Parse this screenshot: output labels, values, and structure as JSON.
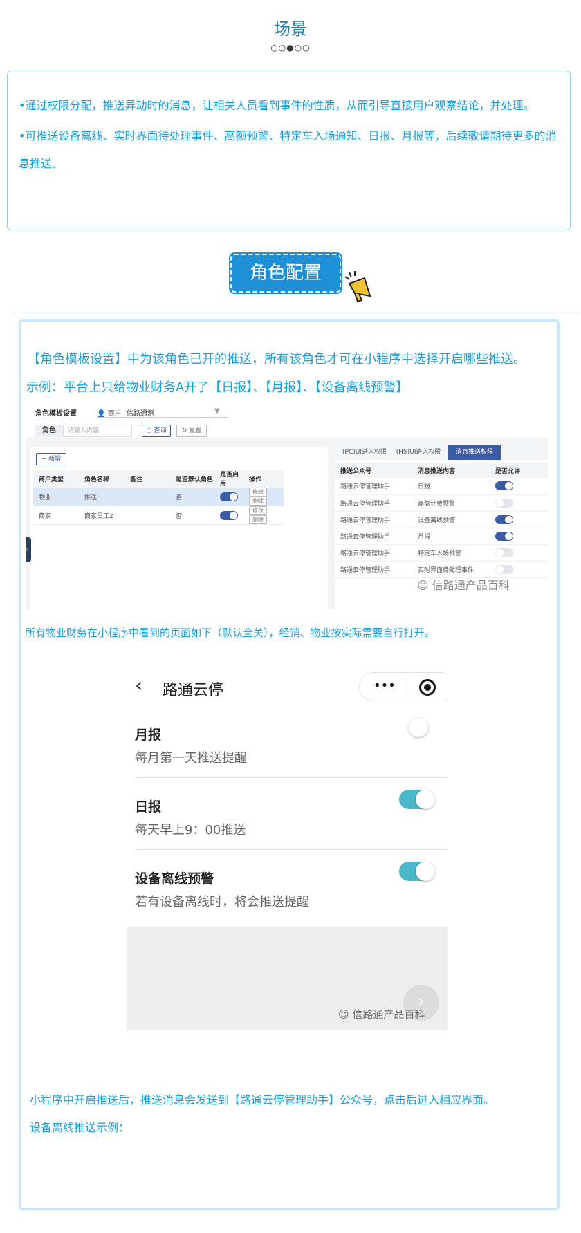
{
  "scene": {
    "title": "场景",
    "dots": "○○●○○",
    "p1": "•通过权限分配，推送异动时的消息，让相关人员看到事件的性质，从而引导直接用户观察结论，并处理。",
    "p2": "•可推送设备离线、实时界面待处理事件、高额预警、特定车入场通知、日报、月报等，后续敬请期待更多的消息推送。"
  },
  "role_config": {
    "badge": "角色配置",
    "line1": "【角色模板设置】中为该角色已开的推送，所有该角色才可在小程序中选择开启哪些推送。",
    "line2": "示例：平台上只给物业财务A开了【日报】、【月报】、【设备离线预警】"
  },
  "admin": {
    "title": "角色模板设置",
    "merchant_label": "商户",
    "merchant_value": "信路通测",
    "role_label": "角色",
    "role_placeholder": "请输入内容",
    "query_button": "查询",
    "reset_button": "重置",
    "add_button": "+ 新增",
    "left_headers": [
      "商户类型",
      "角色名称",
      "备注",
      "是否默认角色",
      "是否启用",
      "操作"
    ],
    "left_rows": [
      {
        "type": "物业",
        "name": "推送",
        "note": "",
        "default": "否",
        "enabled": true
      },
      {
        "type": "商家",
        "name": "商家员工2",
        "note": "",
        "default": "否",
        "enabled": true
      }
    ],
    "edit_label": "修改",
    "delete_label": "删除",
    "tabs": [
      "(PC)UI进入权限",
      "(H5)UI进入权限",
      "消息推送权限"
    ],
    "right_headers": [
      "推送公众号",
      "消息推送内容",
      "是否允许"
    ],
    "right_rows": [
      {
        "account": "路通云停管理助手",
        "content": "日报",
        "allowed": true
      },
      {
        "account": "路通云停管理助手",
        "content": "高额计费预警",
        "allowed": false
      },
      {
        "account": "路通云停管理助手",
        "content": "设备离线预警",
        "allowed": true
      },
      {
        "account": "路通云停管理助手",
        "content": "月报",
        "allowed": true
      },
      {
        "account": "路通云停管理助手",
        "content": "特定车入场预警",
        "allowed": false
      },
      {
        "account": "路通云停管理助手",
        "content": "实时界面待处理事件",
        "allowed": false
      }
    ],
    "watermark": "信路通产品百科"
  },
  "caption1": "所有物业财务在小程序中看到的页面如下（默认全关），经销、物业按实际需要自行打开。",
  "phone": {
    "title": "路通云停",
    "capsule_dots": "•••",
    "items": [
      {
        "title": "月报",
        "desc": "每月第一天推送提醒",
        "on": false
      },
      {
        "title": "日报",
        "desc": "每天早上9：00推送",
        "on": true
      },
      {
        "title": "设备离线预警",
        "desc": "若有设备离线时，将会推送提醒",
        "on": true
      }
    ],
    "watermark": "信路通产品百科"
  },
  "caption2": "小程序中开启推送后，推送消息会发送到【路通云停管理助手】公众号，点击后进入相应界面。",
  "caption3": "设备离线推送示例："
}
